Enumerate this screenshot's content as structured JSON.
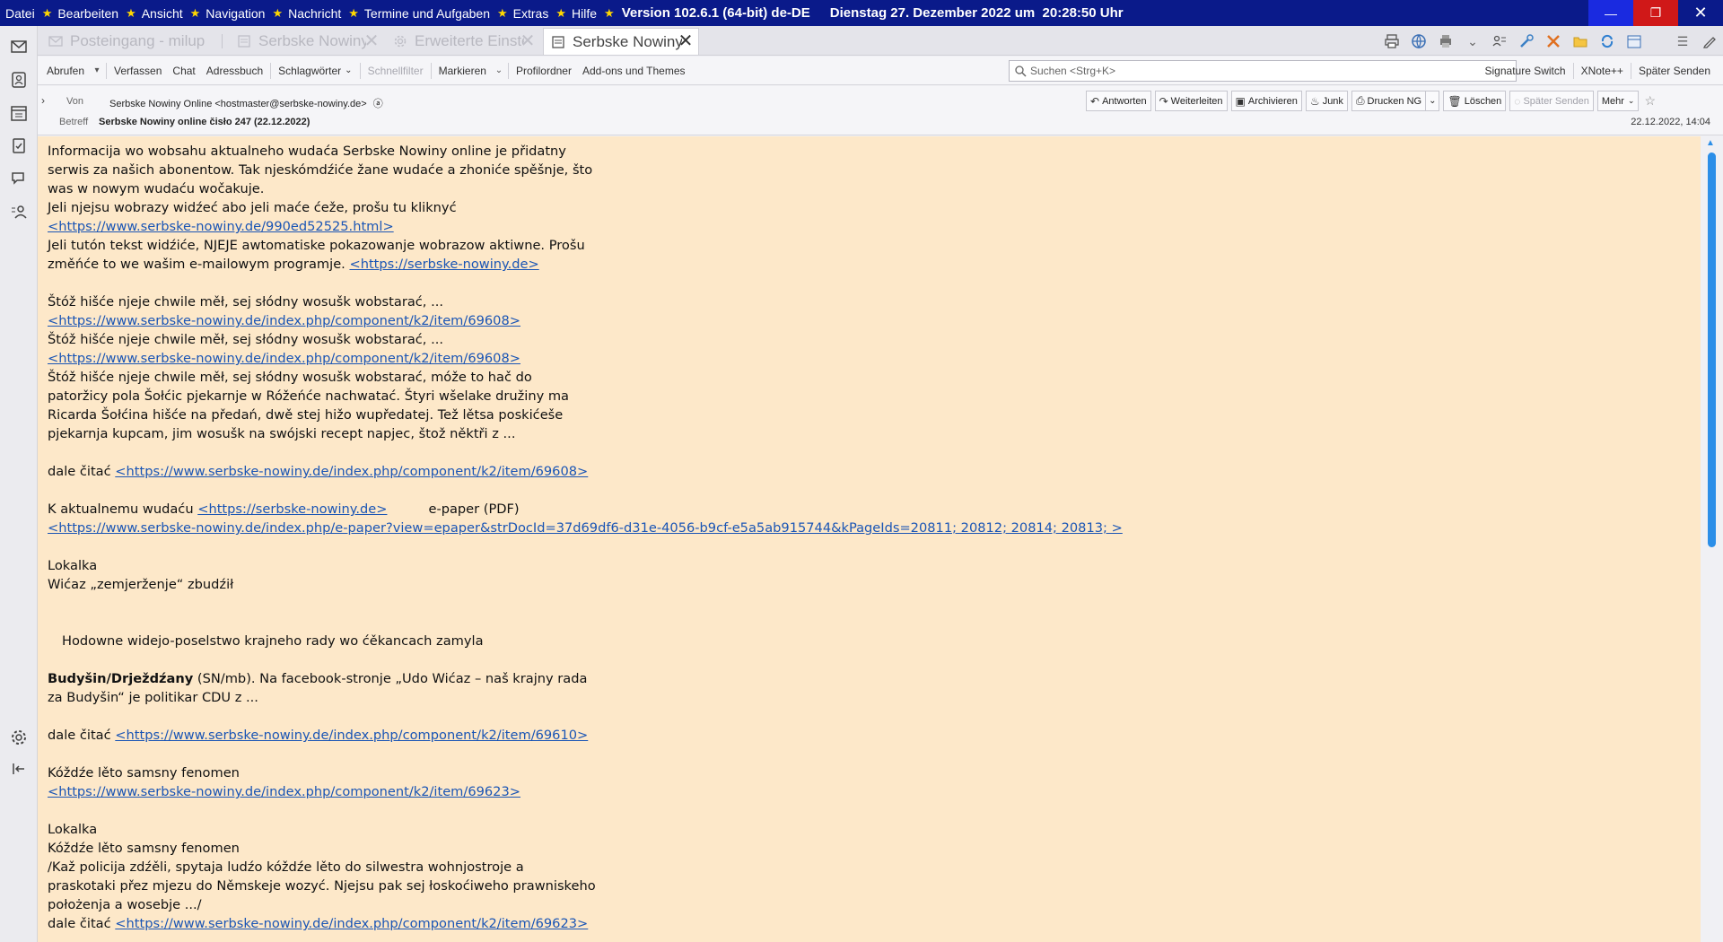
{
  "titlebar": {
    "menu": [
      "Datei",
      "Bearbeiten",
      "Ansicht",
      "Navigation",
      "Nachricht",
      "Termine und Aufgaben",
      "Extras",
      "Hilfe"
    ],
    "version": "Version 102.6.1 (64-bit) de-DE",
    "date": "Dienstag 27. Dezember 2022 um",
    "time": "20:28:50 Uhr",
    "minimize": "—",
    "maximize": "❐",
    "close": "✕"
  },
  "tabs": [
    {
      "label": "Posteingang - milup",
      "active": false
    },
    {
      "label": "Serbske Nowiny o",
      "active": false
    },
    {
      "label": "Erweiterte Einstell",
      "active": false
    },
    {
      "label": "Serbske Nowiny o",
      "active": true
    }
  ],
  "toolbar": {
    "abrufen": "Abrufen",
    "verfassen": "Verfassen",
    "chat": "Chat",
    "adressbuch": "Adressbuch",
    "schlagwoerter": "Schlagwörter",
    "schnellfilter": "Schnellfilter",
    "markieren": "Markieren",
    "profilordner": "Profilordner",
    "addons": "Add-ons und Themes",
    "search_placeholder": "Suchen <Strg+K>",
    "signature_switch": "Signature Switch",
    "xnote": "XNote++",
    "spaeter_senden": "Später Senden"
  },
  "header": {
    "from_label": "Von",
    "from_value": "Serbske Nowiny Online <hostmaster@serbske-nowiny.de>",
    "subject_label": "Betreff",
    "subject_value": "Serbske Nowiny online čisło 247 (22.12.2022)",
    "date": "22.12.2022, 14:04",
    "buttons": {
      "antworten": "Antworten",
      "weiterleiten": "Weiterleiten",
      "archivieren": "Archivieren",
      "junk": "Junk",
      "drucken": "Drucken NG",
      "loeschen": "Löschen",
      "spaeter": "Später Senden",
      "mehr": "Mehr"
    }
  },
  "body": {
    "l1": "Informacija wo wobsahu aktualneho wudaća Serbske Nowiny online je přidatny",
    "l2": "serwis za našich abonentow. Tak njeskómdźiće žane wudaće a zhoniće spěšnje, što",
    "l3": "was w nowym wudaću wočakuje.",
    "l4": "Jeli njejsu wobrazy widźeć abo jeli maće ćeže, prošu tu kliknyć",
    "link1": "<https://www.serbske-nowiny.de/990ed52525.html>",
    "l6": "Jeli tutón tekst widźiće, NJEJE awtomatiske pokazowanje wobrazow aktiwne. Prošu",
    "l7a": "změńće to we wašim e-mailowym programje. ",
    "link2": "<https://serbske-nowiny.de>",
    "l9": "Štóž hišće njeje chwile měł, sej słódny wosušk wobstarać, ...",
    "link3": "<https://www.serbske-nowiny.de/index.php/component/k2/item/69608>",
    "l11": "Štóž hišće njeje chwile měł, sej słódny wosušk wobstarać, ...",
    "link4": "<https://www.serbske-nowiny.de/index.php/component/k2/item/69608>",
    "l13": "Štóž hišće njeje chwile měł, sej słódny wosušk wobstarać, móže to hač do",
    "l14": "patoržicy pola Šołćic pjekarnje w Róžeńće nachwatać. Štyri wšelake družiny ma",
    "l15": "Ricarda Šołćina hišće na předań, dwě stej hižo wupředatej. Tež lětsa poskićeše",
    "l16": "pjekarnja kupcam, jim wosušk na swójski recept napjec, štož něktři z ...",
    "dale": "dale čitać ",
    "link5": "<https://www.serbske-nowiny.de/index.php/component/k2/item/69608>",
    "l19a": "K aktualnemu wudaću ",
    "link6": "<https://serbske-nowiny.de>",
    "l19b": "e-paper (PDF)",
    "link7": "<https://www.serbske-nowiny.de/index.php/e-paper?view=epaper&strDocId=37d69df6-d31e-4056-b9cf-e5a5ab915744&kPageIds=20811; 20812; 20814; 20813; >",
    "l22": "Lokalka",
    "l23": "Wićaz „zemjerženje“ zbudźił",
    "l26": "Hodowne widejo-poselstwo krajneho rady wo ćěkancach zamyla",
    "l28b": "Budyšin/Drježdźany",
    "l28": " (SN/mb). Na facebook-stronje „Udo Wićaz – naš krajny rada",
    "l29": "za Budyšin“ je politikar CDU z ...",
    "link8": "<https://www.serbske-nowiny.de/index.php/component/k2/item/69610>",
    "l33": "Kóždźe lěto samsny fenomen",
    "link9": "<https://www.serbske-nowiny.de/index.php/component/k2/item/69623>",
    "l36": "Lokalka",
    "l37": "Kóždźe lěto samsny fenomen",
    "l38": "/Kaž policija zdźěli, spytaja ludźo kóždźe lěto do silwestra wohnjostroje a",
    "l39": "praskotaki přez mjezu do Němskeje wozyć. Njejsu pak sej łoskoćiweho prawniskeho",
    "l40": "położenja a wosebje .../",
    "link10": "<https://www.serbske-nowiny.de/index.php/component/k2/item/69623>"
  }
}
